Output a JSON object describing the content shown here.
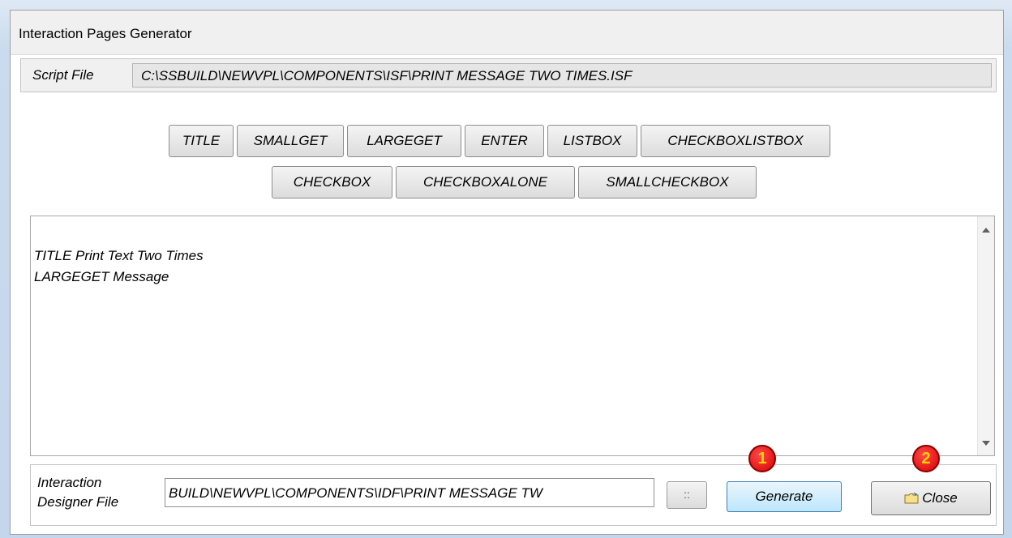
{
  "window": {
    "title": "Interaction Pages Generator"
  },
  "script_file": {
    "label": "Script File",
    "value": "C:\\SSBUILD\\NEWVPL\\COMPONENTS\\ISF\\PRINT MESSAGE TWO TIMES.ISF"
  },
  "commands": {
    "row1": [
      "TITLE",
      "SMALLGET",
      "LARGEGET",
      "ENTER",
      "LISTBOX",
      "CHECKBOXLISTBOX"
    ],
    "row2": [
      "CHECKBOX",
      "CHECKBOXALONE",
      "SMALLCHECKBOX"
    ]
  },
  "editor": {
    "lines": [
      "TITLE Print Text Two Times",
      "LARGEGET Message"
    ]
  },
  "designer_file": {
    "label_line1": "Interaction",
    "label_line2": "Designer File",
    "value": "BUILD\\NEWVPL\\COMPONENTS\\IDF\\PRINT MESSAGE TW",
    "browse_label": "::"
  },
  "buttons": {
    "generate": "Generate",
    "close": "Close"
  },
  "annotations": {
    "badge1": "1",
    "badge2": "2"
  },
  "icons": {
    "close_button": "folder-icon"
  }
}
